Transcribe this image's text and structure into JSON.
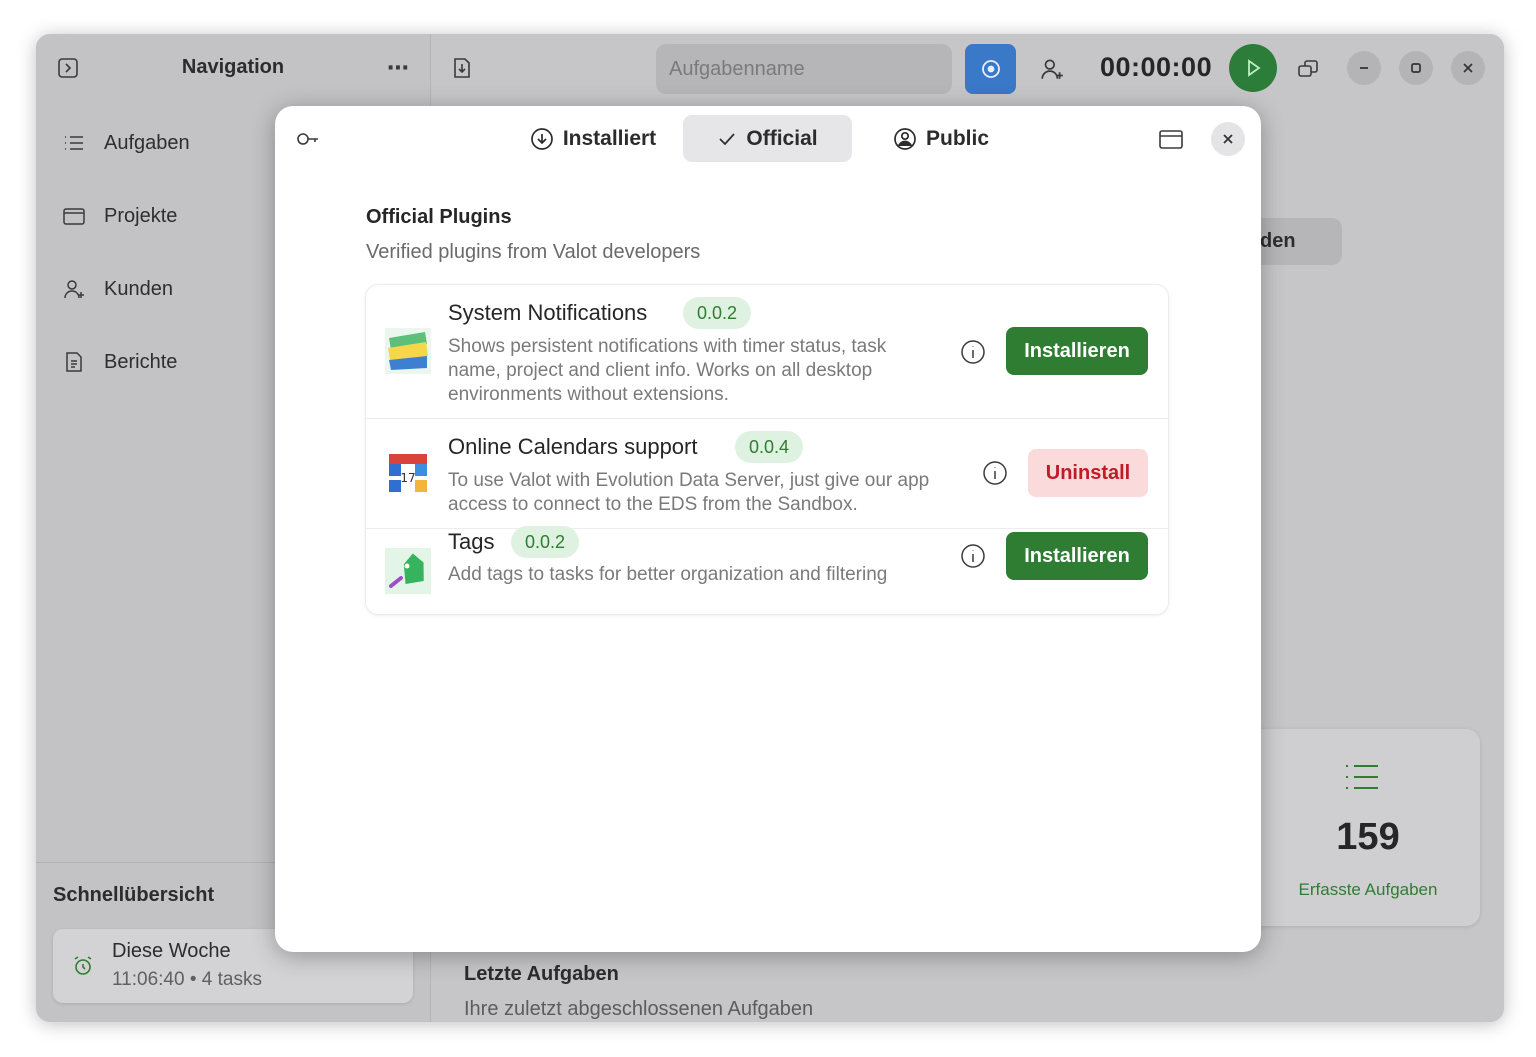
{
  "sidebar": {
    "title": "Navigation",
    "items": [
      {
        "label": "Aufgaben",
        "icon": "list-icon"
      },
      {
        "label": "Projekte",
        "icon": "folder-icon"
      },
      {
        "label": "Kunden",
        "icon": "user-add-icon"
      },
      {
        "label": "Berichte",
        "icon": "report-icon"
      }
    ],
    "quick_overview": {
      "title": "Schnellübersicht",
      "card": {
        "title": "Diese Woche",
        "subtitle": "11:06:40 • 4 tasks",
        "icon": "alarm-icon"
      }
    }
  },
  "header": {
    "task_placeholder": "Aufgabenname",
    "timer": "00:00:00",
    "accent_color": "#3a78c8",
    "play_color": "#2d7d3a"
  },
  "background": {
    "partial_button_label": "den",
    "stat": {
      "value": "159",
      "label": "Erfasste Aufgaben"
    },
    "recent": {
      "title": "Letzte Aufgaben",
      "subtitle": "Ihre zuletzt abgeschlossenen Aufgaben"
    }
  },
  "dialog": {
    "tabs": [
      {
        "label": "Installiert",
        "icon": "download-circle-icon",
        "active": false
      },
      {
        "label": "Official",
        "icon": "check-icon",
        "active": true
      },
      {
        "label": "Public",
        "icon": "person-circle-icon",
        "active": false
      }
    ],
    "section_title": "Official Plugins",
    "section_subtitle": "Verified plugins from Valot developers",
    "plugins": [
      {
        "name": "System Notifications",
        "version": "0.0.2",
        "description": "Shows persistent notifications with timer status, task name, project and client info. Works on all desktop environments without extensions.",
        "action": "Installieren",
        "installed": false,
        "icon": "notifications-plugin-icon"
      },
      {
        "name": "Online Calendars support",
        "version": "0.0.4",
        "description": "To use Valot with Evolution Data Server, just give our app access to connect to the EDS from the Sandbox.",
        "action": "Uninstall",
        "installed": true,
        "icon": "calendar-plugin-icon"
      },
      {
        "name": "Tags",
        "version": "0.0.2",
        "description": "Add tags to tasks for better organization and filtering",
        "action": "Installieren",
        "installed": false,
        "icon": "tag-plugin-icon"
      }
    ],
    "colors": {
      "install": "#2e7d32",
      "uninstall_text": "#c01c28",
      "uninstall_bg": "#fadadb",
      "version_bg": "#dff1e0"
    }
  }
}
